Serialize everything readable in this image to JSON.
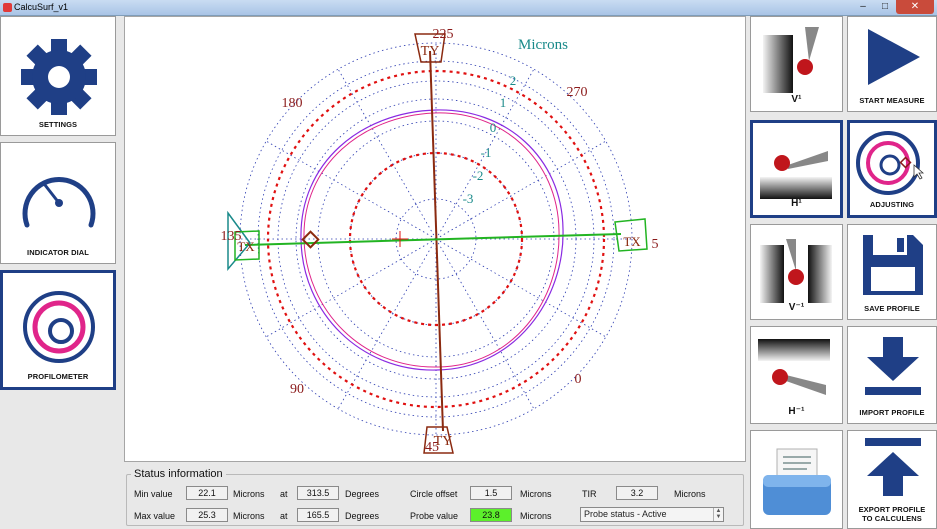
{
  "window": {
    "title": "CalcuSurf_v1"
  },
  "left_menu": {
    "settings": "SETTINGS",
    "indicator_dial": "INDICATOR DIAL",
    "profilometer": "PROFILOMETER"
  },
  "plot": {
    "units_label": "Microns",
    "angle_labels": [
      "225",
      "270",
      "5",
      "0",
      "45",
      "90",
      "135",
      "180"
    ],
    "ring_labels": [
      "2",
      "1",
      "0",
      "-1",
      "-2",
      "-3"
    ],
    "probe_top": "TY",
    "probe_bottom": "TY",
    "probe_right": "TX",
    "probe_left": "TX"
  },
  "status": {
    "legend": "Status information",
    "min_label": "Min value",
    "min_value": "22.1",
    "max_label": "Max value",
    "max_value": "25.3",
    "unit": "Microns",
    "at": "at",
    "min_angle": "313.5",
    "max_angle": "165.5",
    "degrees": "Degrees",
    "circle_offset_label": "Circle offset",
    "circle_offset_value": "1.5",
    "probe_value_label": "Probe value",
    "probe_value": "23.8",
    "tir_label": "TIR",
    "tir_value": "3.2",
    "probe_status": "Probe status - Active"
  },
  "right_menu": {
    "v1": "V¹",
    "start_measure": "START MEASURE",
    "h1": "H¹",
    "adjusting": "ADJUSTING",
    "v_1": "V⁻¹",
    "save_profile": "SAVE PROFILE",
    "h_1": "H⁻¹",
    "import_profile": "IMPORT PROFILE",
    "export_profile_1": "EXPORT PROFILE",
    "export_profile_2": "TO CALCULENS"
  },
  "colors": {
    "brand_blue": "#1f3f86",
    "magenta": "#e0258a",
    "dark_red": "#8b1a1a",
    "green_line": "#22b422",
    "teal": "#1a8a8a",
    "red_dash": "#e01010",
    "grid_blue": "#2a3ab0"
  }
}
